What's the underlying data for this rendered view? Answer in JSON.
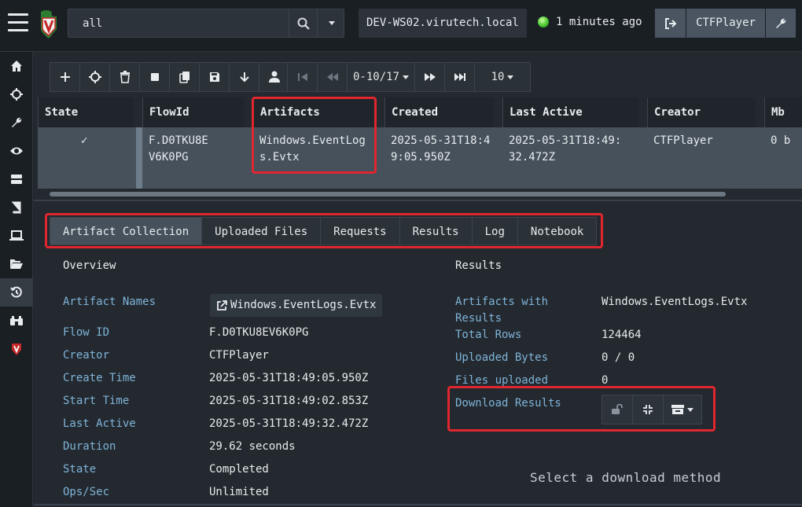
{
  "topbar": {
    "search_value": "all",
    "hostname": "DEV-WS02.virutech.local",
    "last_seen": "1 minutes ago",
    "user": "CTFPlayer"
  },
  "pager": {
    "range": "0-10/17",
    "page_size": "10"
  },
  "grid": {
    "columns": [
      "State",
      "FlowId",
      "Artifacts",
      "Created",
      "Last Active",
      "Creator",
      "Mb"
    ],
    "row": {
      "state": "✓",
      "flow_id": "F.D0TKU8EV6K0PG",
      "artifacts": "Windows.EventLogs.Evtx",
      "created": "2025-05-31T18:49:05.950Z",
      "last_active": "2025-05-31T18:49:32.472Z",
      "creator": "CTFPlayer",
      "mb": "0 b"
    }
  },
  "tabs": [
    "Artifact Collection",
    "Uploaded Files",
    "Requests",
    "Results",
    "Log",
    "Notebook"
  ],
  "overview": {
    "title": "Overview",
    "artifact_names_label": "Artifact Names",
    "artifact_names_value": "Windows.EventLogs.Evtx",
    "rows": [
      {
        "label": "Flow ID",
        "value": "F.D0TKU8EV6K0PG"
      },
      {
        "label": "Creator",
        "value": "CTFPlayer"
      },
      {
        "label": "Create Time",
        "value": "2025-05-31T18:49:05.950Z"
      },
      {
        "label": "Start Time",
        "value": "2025-05-31T18:49:02.853Z"
      },
      {
        "label": "Last Active",
        "value": "2025-05-31T18:49:32.472Z"
      },
      {
        "label": "Duration",
        "value": "29.62 seconds"
      },
      {
        "label": "State",
        "value": "Completed"
      },
      {
        "label": "Ops/Sec",
        "value": "Unlimited"
      }
    ]
  },
  "results": {
    "title": "Results",
    "artifacts_with_results_label": "Artifacts with Results",
    "artifacts_with_results_value": "Windows.EventLogs.Evtx",
    "total_rows_label": "Total Rows",
    "total_rows_value": "124464",
    "uploaded_bytes_label": "Uploaded Bytes",
    "uploaded_bytes_value": "0 / 0",
    "files_uploaded_label": "Files uploaded",
    "files_uploaded_value": "0",
    "download_results_label": "Download Results",
    "select_method": "Select a download method"
  },
  "colors": {
    "accent_blue": "#7fb3d9",
    "highlight_red": "#e0262f",
    "status_green": "#3fbf2b"
  }
}
